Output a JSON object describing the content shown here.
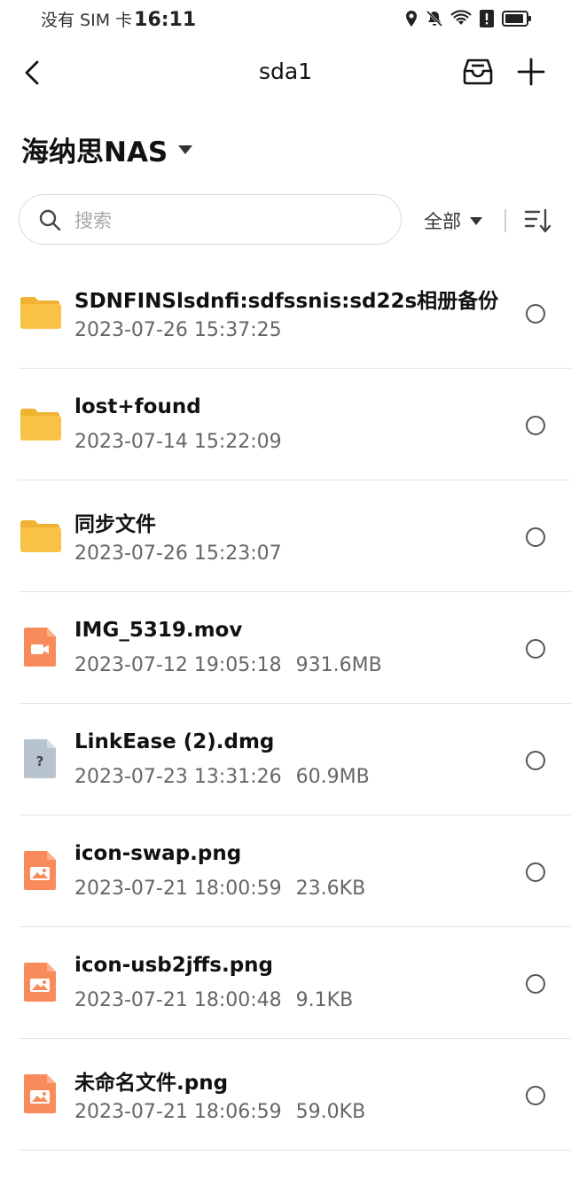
{
  "status_bar": {
    "carrier": "没有 SIM 卡",
    "time": "16:11",
    "icons": [
      "location-icon",
      "bell-off-icon",
      "wifi-icon",
      "alert-icon",
      "battery-icon"
    ]
  },
  "nav": {
    "title": "sda1",
    "icons": [
      "back-icon",
      "inbox-icon",
      "plus-icon"
    ]
  },
  "device": {
    "name": "海纳思NAS"
  },
  "search": {
    "placeholder": "搜索",
    "value": ""
  },
  "filter": {
    "label": "全部"
  },
  "files": [
    {
      "name": "SDNFINSlsdnfi:sdfssnis:sd22s相册备份",
      "date": "2023-07-26 15:37:25",
      "size": "",
      "type": "folder"
    },
    {
      "name": "lost+found",
      "date": "2023-07-14 15:22:09",
      "size": "",
      "type": "folder"
    },
    {
      "name": "同步文件",
      "date": "2023-07-26 15:23:07",
      "size": "",
      "type": "folder"
    },
    {
      "name": "IMG_5319.mov",
      "date": "2023-07-12 19:05:18",
      "size": "931.6MB",
      "type": "video"
    },
    {
      "name": "LinkEase (2).dmg",
      "date": "2023-07-23 13:31:26",
      "size": "60.9MB",
      "type": "unknown"
    },
    {
      "name": "icon-swap.png",
      "date": "2023-07-21 18:00:59",
      "size": "23.6KB",
      "type": "image"
    },
    {
      "name": "icon-usb2jffs.png",
      "date": "2023-07-21 18:00:48",
      "size": "9.1KB",
      "type": "image"
    },
    {
      "name": "未命名文件.png",
      "date": "2023-07-21 18:06:59",
      "size": "59.0KB",
      "type": "image"
    }
  ],
  "colors": {
    "folder": "#f9c146",
    "folder_tab": "#f0b232",
    "media": "#f98b5a",
    "unknown": "#b8c3d0"
  }
}
